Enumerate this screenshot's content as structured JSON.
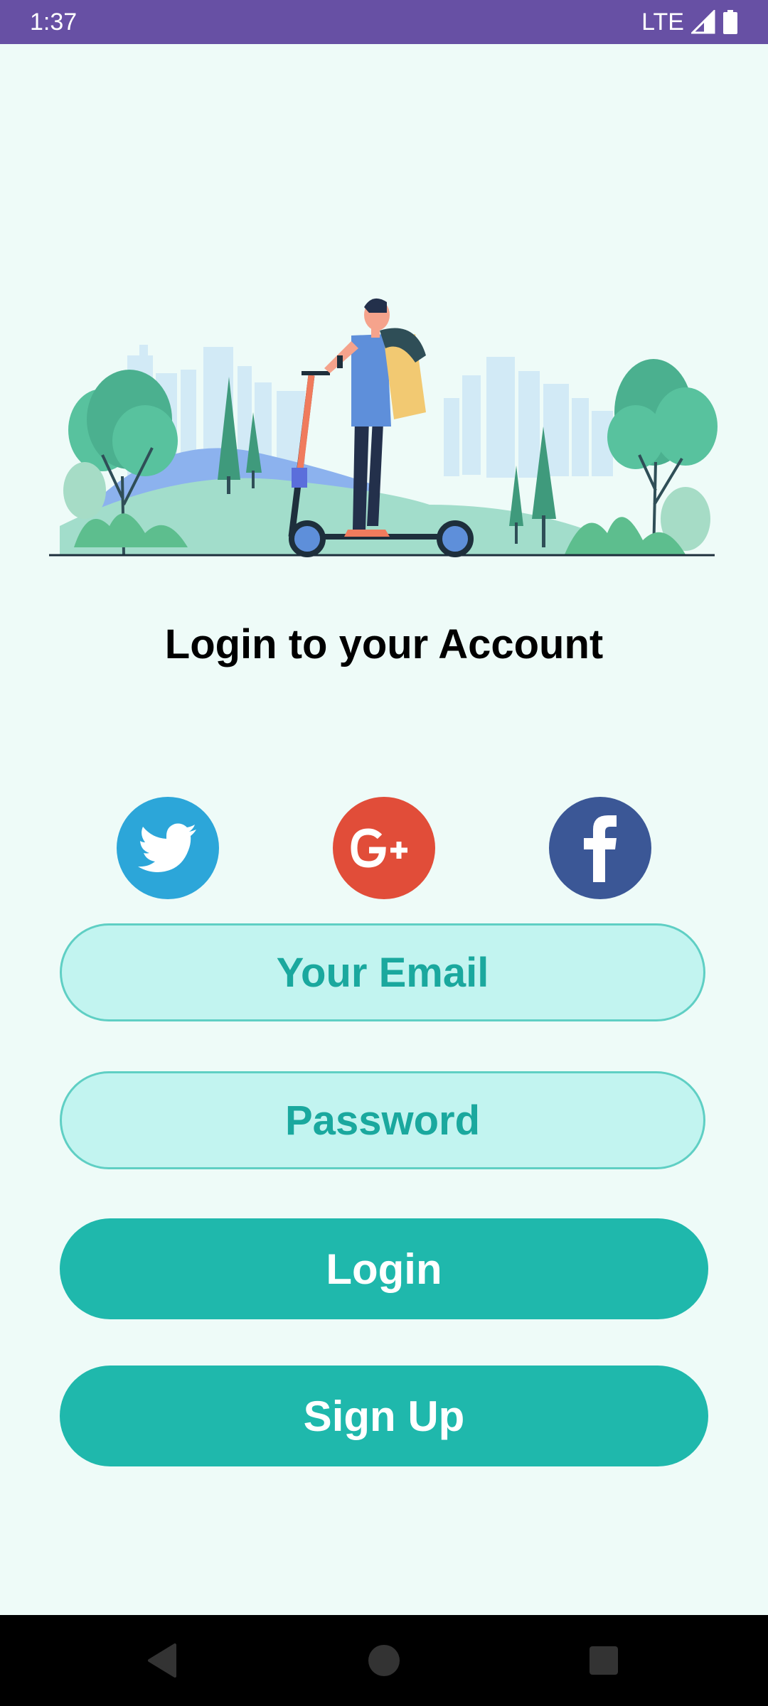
{
  "status_bar": {
    "time": "1:37",
    "network": "LTE",
    "background": "#6750A4"
  },
  "illustration": {
    "subject": "person-on-electric-scooter-in-park"
  },
  "title": "Login to your Account",
  "social_logins": [
    {
      "name": "twitter",
      "icon": "twitter-bird-icon",
      "color": "#2CA6D9"
    },
    {
      "name": "google-plus",
      "icon": "google-plus-icon",
      "glyph": "G+",
      "color": "#E14D39"
    },
    {
      "name": "facebook",
      "icon": "facebook-f-icon",
      "glyph": "f",
      "color": "#3B5796"
    }
  ],
  "form": {
    "email_placeholder": "Your Email",
    "password_placeholder": "Password",
    "login_label": "Login",
    "signup_label": "Sign Up"
  },
  "colors": {
    "background": "#EEFBF8",
    "accent": "#1FB8AC",
    "field_fill": "#C2F4F0",
    "field_text": "#1AA89E"
  },
  "nav_bar": {
    "buttons": [
      "back-icon",
      "home-icon",
      "recents-icon"
    ]
  }
}
